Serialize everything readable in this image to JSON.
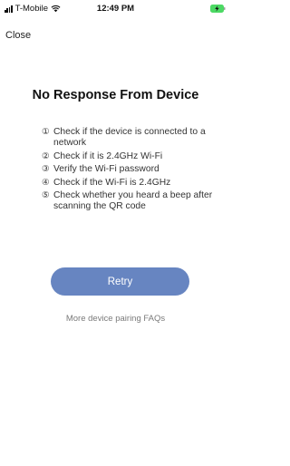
{
  "status_bar": {
    "carrier": "T-Mobile",
    "time": "12:49 PM",
    "battery_color": "#4cd964"
  },
  "nav": {
    "close_label": "Close"
  },
  "title": "No Response From Device",
  "checklist": [
    {
      "number": "①",
      "text": "Check if the device is connected to a network"
    },
    {
      "number": "②",
      "text": "Check if it is 2.4GHz Wi-Fi"
    },
    {
      "number": "③",
      "text": "Verify the Wi-Fi password"
    },
    {
      "number": "④",
      "text": "Check if the Wi-Fi is 2.4GHz"
    },
    {
      "number": "⑤",
      "text": "Check whether you heard a beep after scanning the QR code"
    }
  ],
  "retry_label": "Retry",
  "faq_link": "More device pairing FAQs",
  "colors": {
    "accent": "#6785c1"
  }
}
